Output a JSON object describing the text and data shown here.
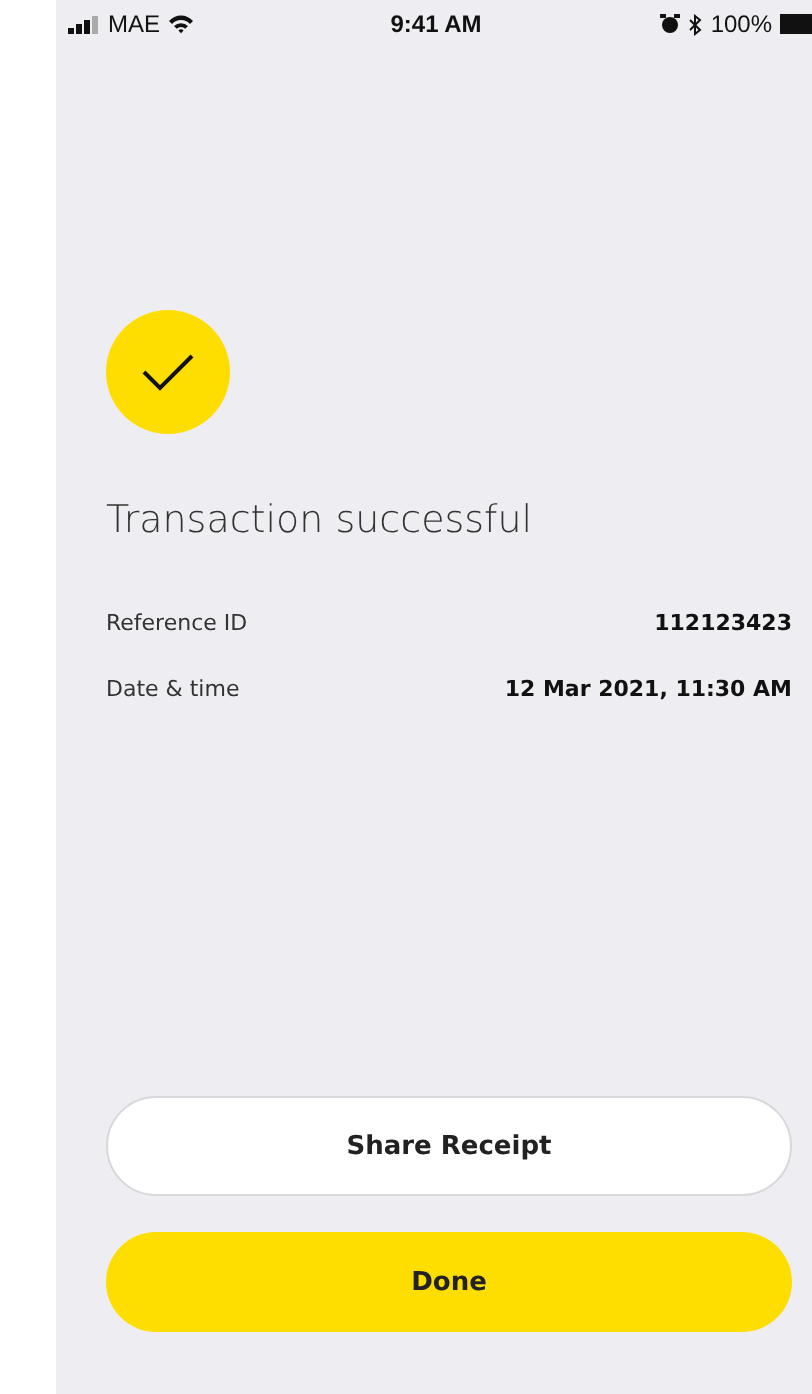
{
  "status_bar": {
    "carrier": "MAE",
    "time": "9:41 AM",
    "battery": "100%"
  },
  "title": "Transaction successful",
  "details": [
    {
      "label": "Reference ID",
      "value": "112123423"
    },
    {
      "label": "Date & time",
      "value": "12 Mar 2021, 11:30 AM"
    }
  ],
  "buttons": [
    {
      "label": "Share Receipt",
      "kind": "secondary"
    },
    {
      "label": "Done",
      "kind": "primary"
    }
  ]
}
